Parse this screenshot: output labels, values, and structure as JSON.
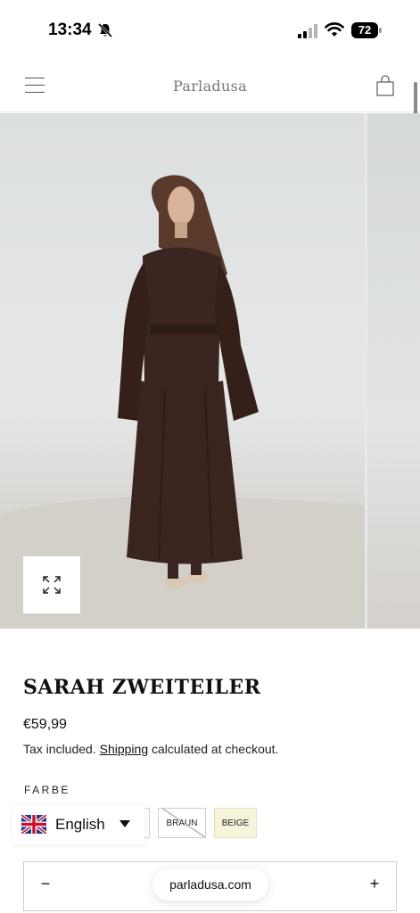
{
  "status_bar": {
    "time": "13:34",
    "battery": "72"
  },
  "header": {
    "brand": "Parladusa"
  },
  "product": {
    "title": "SARAH ZWEITEILER",
    "price": "€59,99",
    "tax_prefix": "Tax included.",
    "shipping_link": "Shipping",
    "tax_suffix": "calculated at checkout.",
    "color_label": "FARBE",
    "swatches": [
      {
        "label": "BRAUN",
        "available": false
      },
      {
        "label": "BEIGE",
        "available": true,
        "color": "#f6f5dc"
      }
    ]
  },
  "language": {
    "selected": "English"
  },
  "quantity": {
    "minus": "−",
    "plus": "+"
  },
  "browser": {
    "url": "parladusa.com"
  },
  "colors": {
    "dress": "#3b2520",
    "background": "#e6e8e8"
  }
}
